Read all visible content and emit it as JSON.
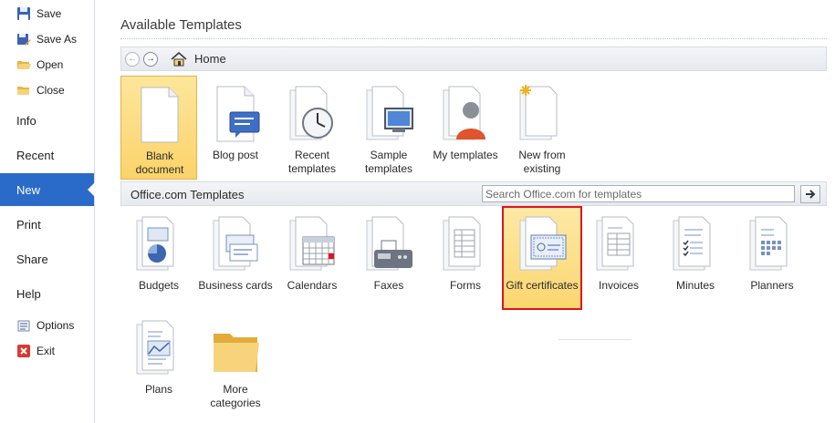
{
  "sidebar": {
    "items": [
      {
        "label": "Save",
        "icon": "save-icon"
      },
      {
        "label": "Save As",
        "icon": "save-as-icon"
      },
      {
        "label": "Open",
        "icon": "open-folder-icon"
      },
      {
        "label": "Close",
        "icon": "close-folder-icon"
      },
      {
        "label": "Info"
      },
      {
        "label": "Recent"
      },
      {
        "label": "New"
      },
      {
        "label": "Print"
      },
      {
        "label": "Share"
      },
      {
        "label": "Help"
      },
      {
        "label": "Options",
        "icon": "options-icon"
      },
      {
        "label": "Exit",
        "icon": "exit-icon"
      }
    ],
    "active": "New",
    "accent": "#2a6bc9"
  },
  "main": {
    "title": "Available Templates",
    "nav": {
      "home_label": "Home"
    },
    "available": [
      {
        "label": "Blank document",
        "icon": "blank-document-icon"
      },
      {
        "label": "Blog post",
        "icon": "blog-post-icon"
      },
      {
        "label": "Recent templates",
        "icon": "recent-templates-icon"
      },
      {
        "label": "Sample templates",
        "icon": "sample-templates-icon"
      },
      {
        "label": "My templates",
        "icon": "my-templates-icon"
      },
      {
        "label": "New from existing",
        "icon": "new-from-existing-icon"
      }
    ],
    "office": {
      "title": "Office.com Templates",
      "search_placeholder": "Search Office.com for templates",
      "items": [
        {
          "label": "Budgets",
          "icon": "budgets-icon"
        },
        {
          "label": "Business cards",
          "icon": "business-cards-icon"
        },
        {
          "label": "Calendars",
          "icon": "calendars-icon"
        },
        {
          "label": "Faxes",
          "icon": "faxes-icon"
        },
        {
          "label": "Forms",
          "icon": "forms-icon"
        },
        {
          "label": "Gift certificates",
          "icon": "gift-certificates-icon"
        },
        {
          "label": "Invoices",
          "icon": "invoices-icon"
        },
        {
          "label": "Minutes",
          "icon": "minutes-icon"
        },
        {
          "label": "Planners",
          "icon": "planners-icon"
        },
        {
          "label": "Plans",
          "icon": "plans-icon"
        },
        {
          "label": "More categories",
          "icon": "folder-icon"
        }
      ]
    }
  },
  "colors": {
    "selected_bg": "#fbd36a",
    "highlight_border": "#e0141c"
  }
}
